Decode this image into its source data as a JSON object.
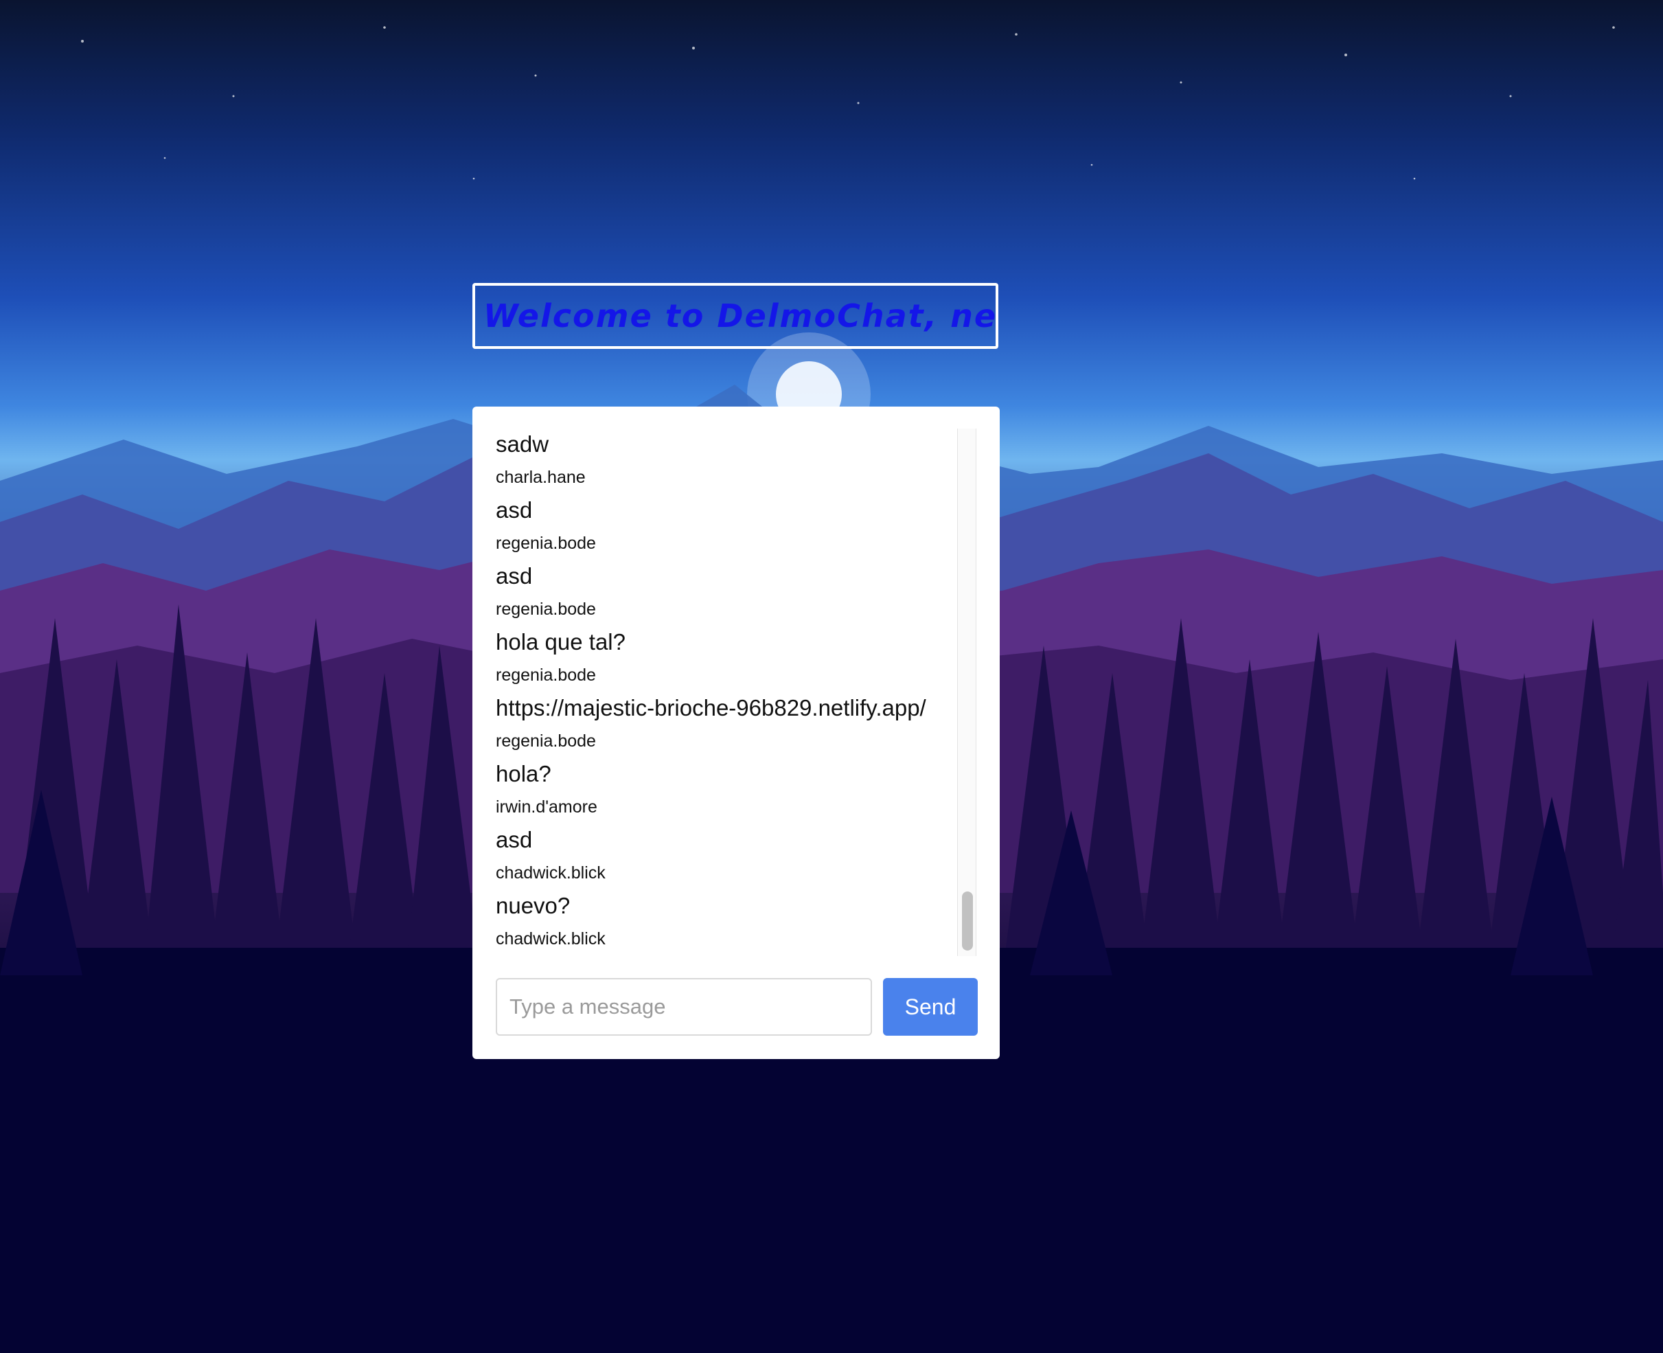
{
  "header": {
    "title": "Welcome to DelmoChat, new"
  },
  "chat": {
    "messages": [
      {
        "text": "sadw",
        "user": "charla.hane"
      },
      {
        "text": "asd",
        "user": "regenia.bode"
      },
      {
        "text": "asd",
        "user": "regenia.bode"
      },
      {
        "text": "hola que tal?",
        "user": "regenia.bode"
      },
      {
        "text": "https://majestic-brioche-96b829.netlify.app/",
        "user": "regenia.bode"
      },
      {
        "text": "hola?",
        "user": "irwin.d'amore"
      },
      {
        "text": "asd",
        "user": "chadwick.blick"
      },
      {
        "text": "nuevo?",
        "user": "chadwick.blick"
      }
    ]
  },
  "composer": {
    "placeholder": "Type a message",
    "send_label": "Send"
  },
  "colors": {
    "title": "#1416e8",
    "send_button": "#4a82ec",
    "background_deep": "#040333"
  }
}
